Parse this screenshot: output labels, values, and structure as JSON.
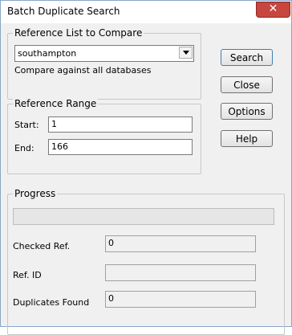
{
  "window": {
    "title": "Batch Duplicate Search",
    "close_glyph": "✕"
  },
  "reference_list": {
    "group_label": "Reference List to Compare",
    "selected": "southampton",
    "note": "Compare against all databases"
  },
  "reference_range": {
    "group_label": "Reference Range",
    "start_label": "Start:",
    "start_value": "1",
    "end_label": "End:",
    "end_value": "166"
  },
  "buttons": {
    "search": "Search",
    "close": "Close",
    "options": "Options",
    "help": "Help"
  },
  "progress": {
    "group_label": "Progress",
    "fraction": 0,
    "checked_label": "Checked Ref.",
    "checked_value": "0",
    "refid_label": "Ref. ID",
    "refid_value": "",
    "dups_label": "Duplicates Found",
    "dups_value": "0"
  }
}
